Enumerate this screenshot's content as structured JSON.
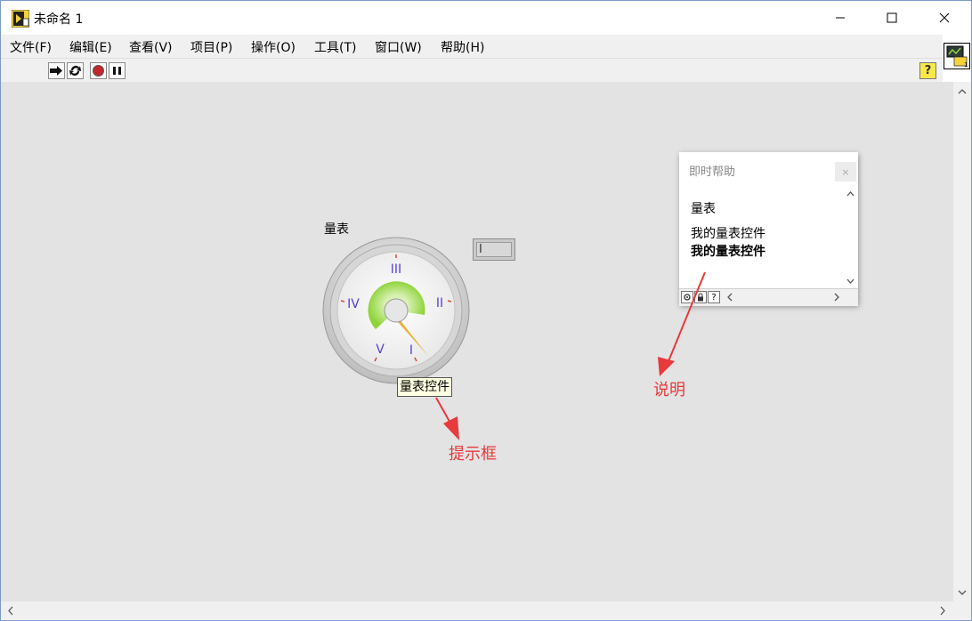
{
  "window": {
    "title": "未命名 1"
  },
  "menu": [
    {
      "label": "文件(F)"
    },
    {
      "label": "编辑(E)"
    },
    {
      "label": "查看(V)"
    },
    {
      "label": "项目(P)"
    },
    {
      "label": "操作(O)"
    },
    {
      "label": "工具(T)"
    },
    {
      "label": "窗口(W)"
    },
    {
      "label": "帮助(H)"
    }
  ],
  "toolbar": {
    "help_glyph": "?"
  },
  "gauge": {
    "label": "量表",
    "indicator_value": "I",
    "scale_marks": [
      "I",
      "II",
      "III",
      "IV",
      "V"
    ],
    "tooltip": "量表控件",
    "scale_color": "#5a3fd6",
    "fill_color": "#8fd43a",
    "needle_color": "#e9b23a"
  },
  "context_help": {
    "title": "即时帮助",
    "close_glyph": "×",
    "heading": "量表",
    "description": "我的量表控件",
    "description_bold": "我的量表控件"
  },
  "annotations": {
    "tip_box": "提示框",
    "description": "说明",
    "color": "#e8393b"
  }
}
